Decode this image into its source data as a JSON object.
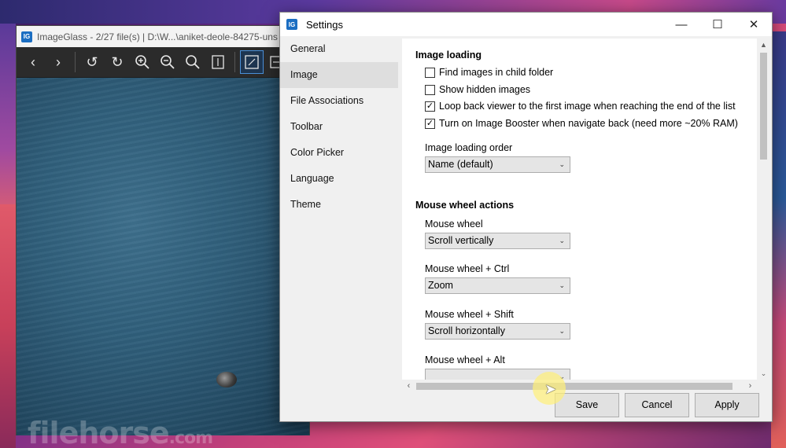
{
  "imageglass": {
    "title": "ImageGlass - 2/27 file(s)  |  D:\\W...\\aniket-deole-84275-uns",
    "logo_text": "IG",
    "toolbar_icons": [
      "arrow-left-icon",
      "arrow-right-icon",
      "rotate-left-icon",
      "rotate-right-icon",
      "zoom-in-icon",
      "zoom-out-icon",
      "zoom-fit-icon",
      "scale-to-height-icon",
      "auto-zoom-icon",
      "scale-to-width-icon"
    ],
    "watermark": "filehorse",
    "watermark_suffix": ".com"
  },
  "settings": {
    "title": "Settings",
    "logo_text": "IG",
    "nav": [
      {
        "label": "General"
      },
      {
        "label": "Image"
      },
      {
        "label": "File Associations"
      },
      {
        "label": "Toolbar"
      },
      {
        "label": "Color Picker"
      },
      {
        "label": "Language"
      },
      {
        "label": "Theme"
      }
    ],
    "selected_nav": "Image",
    "image_loading": {
      "title": "Image loading",
      "options": [
        {
          "label": "Find images in child folder",
          "checked": false
        },
        {
          "label": "Show hidden images",
          "checked": false
        },
        {
          "label": "Loop back viewer to the first image when reaching the end of the list",
          "checked": true
        },
        {
          "label": "Turn on Image Booster when navigate back (need more ~20% RAM)",
          "checked": true
        }
      ],
      "order_label": "Image loading order",
      "order_value": "Name (default)"
    },
    "mouse_wheel": {
      "title": "Mouse wheel actions",
      "items": [
        {
          "label": "Mouse wheel",
          "value": "Scroll vertically"
        },
        {
          "label": "Mouse wheel + Ctrl",
          "value": "Zoom"
        },
        {
          "label": "Mouse wheel + Shift",
          "value": "Scroll horizontally"
        },
        {
          "label": "Mouse wheel + Alt",
          "value": ""
        }
      ]
    },
    "buttons": {
      "save": "Save",
      "cancel": "Cancel",
      "apply": "Apply"
    }
  }
}
